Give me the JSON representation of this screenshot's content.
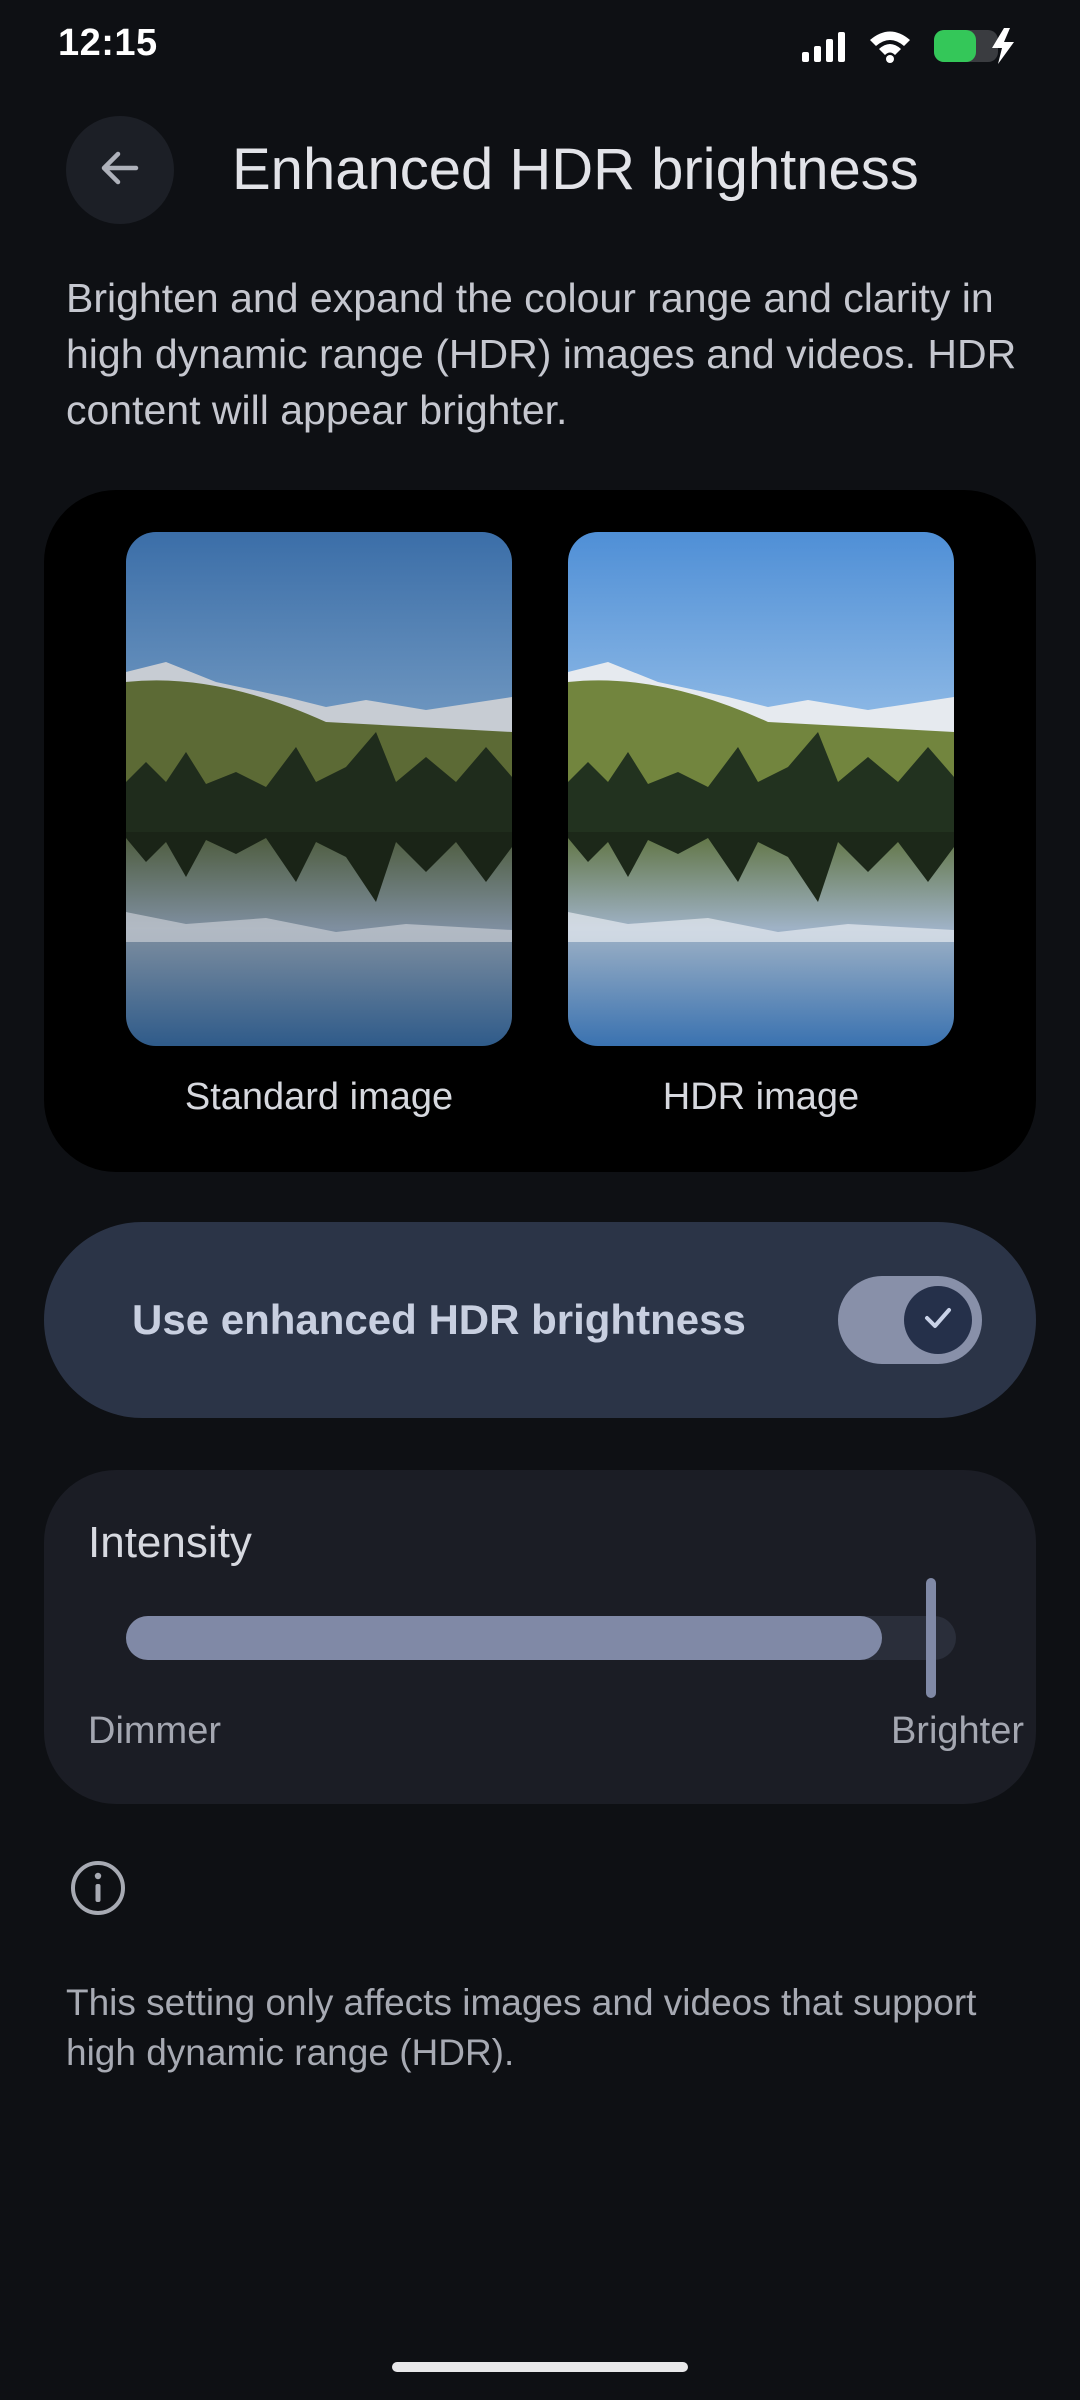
{
  "status_bar": {
    "time": "12:15",
    "icons": [
      "signal-icon",
      "wifi-icon",
      "battery-charging-icon"
    ],
    "battery_color": "#34c759"
  },
  "header": {
    "back_icon": "arrow-left-icon",
    "title": "Enhanced HDR brightness"
  },
  "description": "Brighten and expand the colour range and clarity in high dynamic range (HDR) images and videos. HDR content will appear brighter.",
  "preview": {
    "standard_label": "Standard image",
    "hdr_label": "HDR image"
  },
  "toggle": {
    "label": "Use enhanced HDR brightness",
    "checked": true,
    "thumb_icon": "check-icon"
  },
  "intensity": {
    "title": "Intensity",
    "min_label": "Dimmer",
    "max_label": "Brighter",
    "value_fraction": 0.98
  },
  "info": {
    "icon": "info-icon",
    "text": "This setting only affects images and videos that support high dynamic range (HDR)."
  },
  "colors": {
    "background": "#0e1014",
    "toggle_container": "#2b3447",
    "slider_fill": "#8089a6"
  }
}
